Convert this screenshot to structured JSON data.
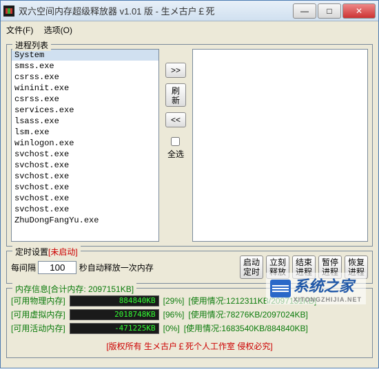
{
  "window": {
    "title": "双六空间内存超级释放器 v1.01 版 - 生メ古户￡死",
    "min": "—",
    "max": "□",
    "close": "✕"
  },
  "menubar": {
    "file": "文件(F)",
    "options": "选项(O)"
  },
  "process": {
    "legend": "进程列表",
    "items": [
      "System",
      "smss.exe",
      "csrss.exe",
      "wininit.exe",
      "csrss.exe",
      "services.exe",
      "lsass.exe",
      "lsm.exe",
      "winlogon.exe",
      "svchost.exe",
      "svchost.exe",
      "svchost.exe",
      "svchost.exe",
      "svchost.exe",
      "svchost.exe",
      "ZhuDongFangYu.exe"
    ],
    "btn_forward": ">>",
    "btn_refresh": "刷\n新",
    "btn_back": "<<",
    "check_all": "全选"
  },
  "timer": {
    "legend_prefix": "定时设置",
    "legend_status": "[未启动]",
    "label_prefix": "每间隔",
    "interval": "100",
    "label_suffix": "秒自动释放一次内存",
    "buttons": {
      "start": "启动\n定时",
      "release": "立刻\n释放",
      "end": "结束\n进程",
      "pause": "暂停\n进程",
      "resume": "恢复\n进程"
    }
  },
  "mem": {
    "legend_prefix": "内存信息",
    "legend_total": "[合计内存: 2097151KB]",
    "rows": [
      {
        "label": "[可用物理内存]",
        "value": "884840KB",
        "pct": "[29%]",
        "usage": "[使用情况:1212311KB/2097151KB]"
      },
      {
        "label": "[可用虚拟内存]",
        "value": "2018748KB",
        "pct": "[96%]",
        "usage": "[使用情况:78276KB/2097024KB]"
      },
      {
        "label": "[可用活动内存]",
        "value": "-471225KB",
        "pct": "[0%]",
        "usage": "[使用情况:1683540KB/884840KB]"
      }
    ]
  },
  "copyright": "[版权所有 生メ古户￡死个人工作室 侵权必究]",
  "watermark": {
    "text": "系统之家",
    "sub": "XITONGZHIJIA.NET"
  }
}
